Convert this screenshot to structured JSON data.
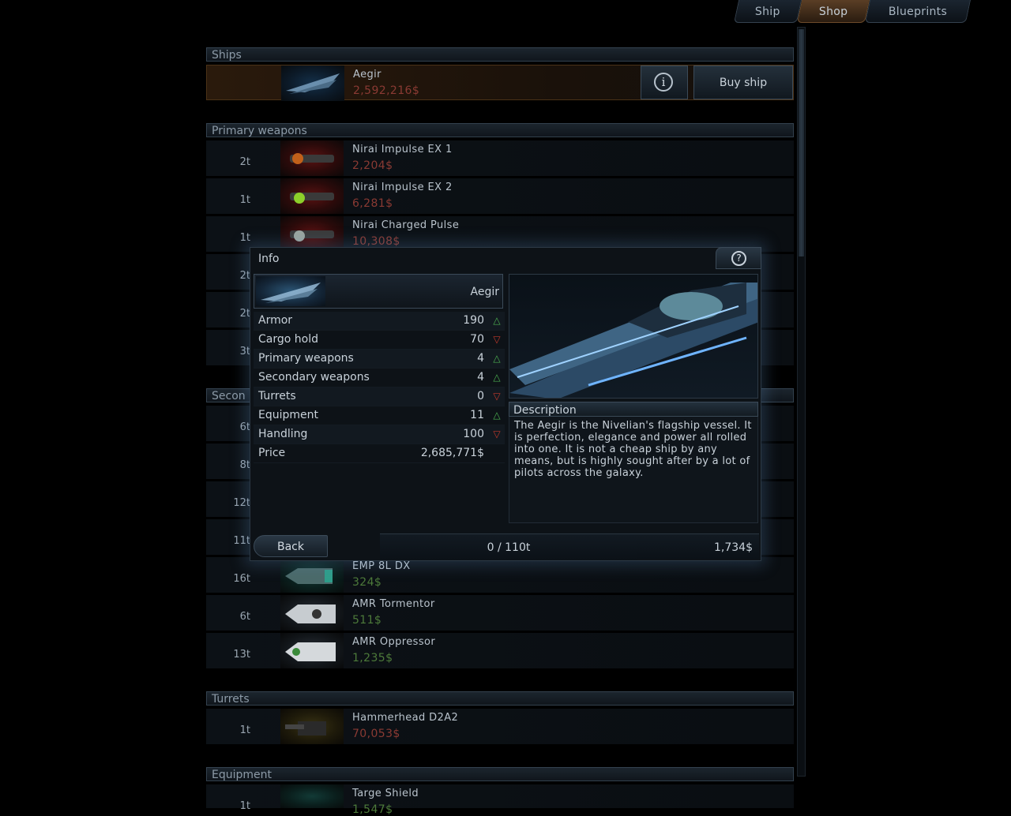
{
  "tabs": [
    {
      "label": "Ship",
      "active": false
    },
    {
      "label": "Shop",
      "active": true
    },
    {
      "label": "Blueprints",
      "active": false
    }
  ],
  "sections": {
    "ships": "Ships",
    "primary": "Primary weapons",
    "secondary": "Secon",
    "turrets": "Turrets",
    "equipment": "Equipment"
  },
  "ship_row": {
    "name": "Aegir",
    "price": "2,592,216$",
    "buy_label": "Buy ship",
    "info_glyph": "i"
  },
  "primary_rows": [
    {
      "tons": "2t",
      "name": "Nirai Impulse EX 1",
      "price": "2,204$"
    },
    {
      "tons": "1t",
      "name": "Nirai Impulse EX 2",
      "price": "6,281$"
    },
    {
      "tons": "1t",
      "name": "Nirai Charged Pulse",
      "price": "10,308$"
    },
    {
      "tons": "2t",
      "name": "",
      "price": ""
    },
    {
      "tons": "2t",
      "name": "",
      "price": ""
    },
    {
      "tons": "3t",
      "name": "",
      "price": ""
    }
  ],
  "secondary_rows": [
    {
      "tons": "6t",
      "name": "",
      "price": ""
    },
    {
      "tons": "8t",
      "name": "",
      "price": ""
    },
    {
      "tons": "12t",
      "name": "",
      "price": ""
    },
    {
      "tons": "11t",
      "name": "",
      "price": ""
    },
    {
      "tons": "16t",
      "name": "EMP 8L DX",
      "price": "324$"
    },
    {
      "tons": "6t",
      "name": "AMR Tormentor",
      "price": "511$"
    },
    {
      "tons": "13t",
      "name": "AMR Oppressor",
      "price": "1,235$"
    }
  ],
  "turret_rows": [
    {
      "tons": "1t",
      "name": "Hammerhead D2A2",
      "price": "70,053$"
    }
  ],
  "equipment_rows": [
    {
      "tons": "1t",
      "name": "Targe Shield",
      "price": "1,547$"
    }
  ],
  "modal": {
    "title": "Info",
    "help_glyph": "?",
    "ship_name": "Aegir",
    "stats": [
      {
        "label": "Armor",
        "value": "190",
        "trend": "up"
      },
      {
        "label": "Cargo hold",
        "value": "70",
        "trend": "down"
      },
      {
        "label": "Primary weapons",
        "value": "4",
        "trend": "up"
      },
      {
        "label": "Secondary weapons",
        "value": "4",
        "trend": "up"
      },
      {
        "label": "Turrets",
        "value": "0",
        "trend": "down"
      },
      {
        "label": "Equipment",
        "value": "11",
        "trend": "up"
      },
      {
        "label": "Handling",
        "value": "100",
        "trend": "down"
      },
      {
        "label": "Price",
        "value": "2,685,771$",
        "trend": "none"
      }
    ],
    "description_header": "Description",
    "description": "The Aegir is the Nivelian's flagship vessel. It is perfection, elegance and power all rolled into one. It is not a cheap ship by any means, but is highly sought after by a lot of pilots across the galaxy.",
    "back_label": "Back",
    "cargo": "0 / 110t",
    "money": "1,734$"
  },
  "colors": {
    "price_red": "#8a3a33",
    "price_green": "#4d7a3a",
    "accent_orange": "#6d4b2a"
  }
}
